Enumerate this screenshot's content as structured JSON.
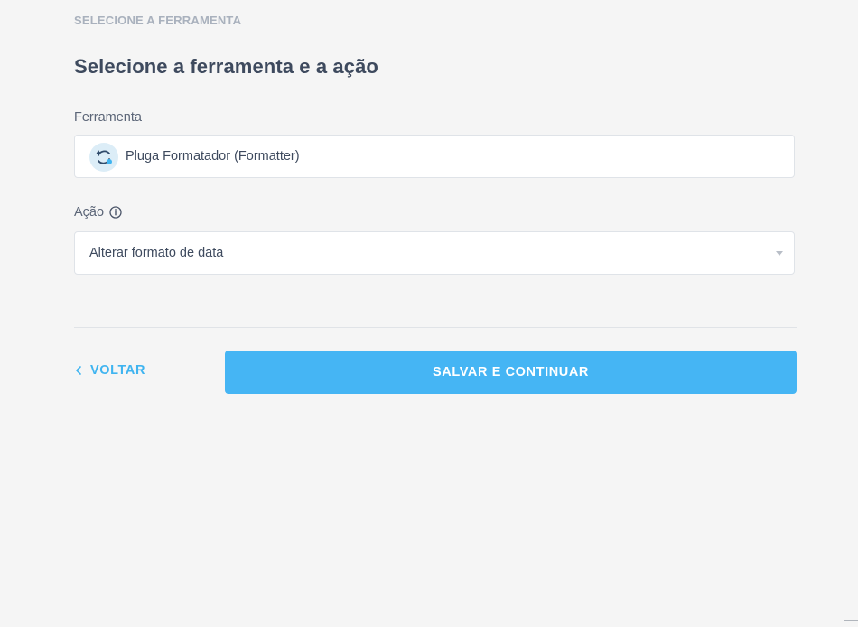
{
  "header": {
    "step_label": "SELECIONE A FERRAMENTA",
    "title": "Selecione a ferramenta e a ação"
  },
  "tool_field": {
    "label": "Ferramenta",
    "value": "Pluga Formatador (Formatter)",
    "icon": "formatter-cycle-icon"
  },
  "action_field": {
    "label": "Ação",
    "info_icon": "info-icon",
    "selected_value": "Alterar formato de data",
    "dropdown_icon": "caret-down-icon"
  },
  "footer": {
    "back_label": "VOLTAR",
    "back_icon": "chevron-left-icon",
    "primary_label": "SALVAR E CONTINUAR"
  },
  "colors": {
    "background": "#f5f5f5",
    "primary": "#45b5f4",
    "link": "#3fb4f0",
    "text": "#3e4a5e",
    "muted": "#a9b1bd"
  }
}
